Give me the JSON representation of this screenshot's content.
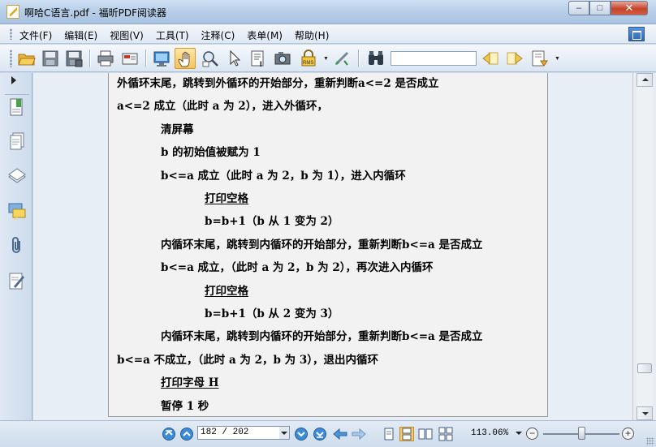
{
  "window": {
    "title": "啊哈C语言.pdf - 福昕PDF阅读器",
    "minimize_label": "–",
    "maximize_label": "□",
    "close_label": "✕"
  },
  "menu": {
    "items": [
      "文件(F)",
      "编辑(E)",
      "视图(V)",
      "工具(T)",
      "注释(C)",
      "表单(M)",
      "帮助(H)"
    ]
  },
  "toolbar": {
    "icons": [
      "open-folder-icon",
      "save-icon",
      "save-as-icon",
      "print-icon",
      "email-icon",
      "fullscreen-icon",
      "hand-tool-icon",
      "zoom-tool-icon",
      "select-tool-icon",
      "text-select-icon",
      "snapshot-icon",
      "rms-icon",
      "sign-icon",
      "find-icon",
      "previous-result-icon",
      "next-result-icon",
      "highlight-icon"
    ],
    "active_tool": "hand-tool-icon",
    "search": {
      "value": "",
      "placeholder": ""
    }
  },
  "nav_panel": {
    "icons": [
      "bookmarks-icon",
      "pages-icon",
      "layers-icon",
      "comments-icon",
      "attachments-icon",
      "signature-icon"
    ]
  },
  "document": {
    "lines": [
      {
        "text": "外循环末尾，跳转到外循环的开始部分，重新判断a<=2 是否成立",
        "indent": 0,
        "underline": false
      },
      {
        "text": "a<=2 成立（此时 a 为 2），进入外循环，",
        "indent": 0,
        "underline": false
      },
      {
        "text": "清屏幕",
        "indent": 1,
        "underline": false
      },
      {
        "text": "b 的初始值被赋为 1",
        "indent": 1,
        "underline": false
      },
      {
        "text": "b<=a 成立（此时 a 为 2，b 为 1），进入内循环",
        "indent": 1,
        "underline": false
      },
      {
        "text": "打印空格",
        "indent": 2,
        "underline": true
      },
      {
        "text": "b=b+1（b 从 1 变为 2）",
        "indent": 2,
        "underline": false
      },
      {
        "text": "内循环末尾，跳转到内循环的开始部分，重新判断b<=a 是否成立",
        "indent": 1,
        "underline": false
      },
      {
        "text": "b<=a 成立，（此时 a 为 2，b 为 2），再次进入内循环",
        "indent": 1,
        "underline": false
      },
      {
        "text": "打印空格",
        "indent": 2,
        "underline": true
      },
      {
        "text": "b=b+1（b 从 2 变为 3）",
        "indent": 2,
        "underline": false
      },
      {
        "text": "内循环末尾，跳转到内循环的开始部分，重新判断b<=a 是否成立",
        "indent": 1,
        "underline": false
      },
      {
        "text": "b<=a 不成立，（此时 a 为 2，b 为 3），退出内循环",
        "indent": 0,
        "underline": false
      },
      {
        "text": "打印字母 H",
        "indent": 1,
        "underline": true
      },
      {
        "text": "暂停 1 秒",
        "indent": 1,
        "underline": false
      }
    ]
  },
  "status": {
    "page_field": "182 / 202",
    "zoom": "113.06%",
    "zoom_level_fraction": 0.5
  }
}
